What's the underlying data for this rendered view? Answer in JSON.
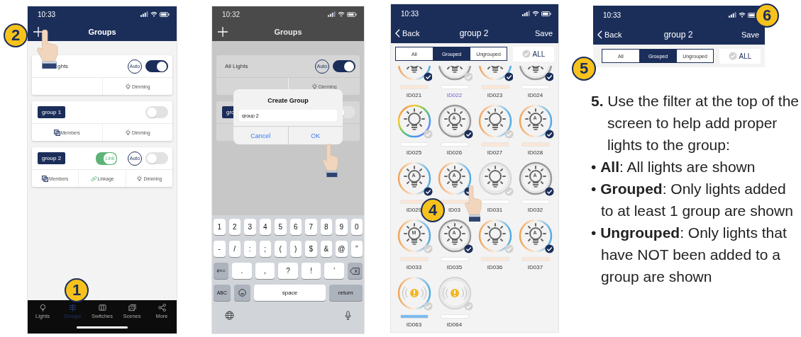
{
  "screens": [
    {
      "kind": "groups",
      "time": "10:33",
      "title": "Groups",
      "cards": [
        {
          "label": "ghts",
          "kind": "plain",
          "auto": "Auto",
          "on": true,
          "actions": [
            {
              "kind": "empty"
            },
            {
              "kind": "dimming",
              "label": "Dimming"
            }
          ]
        },
        {
          "label": "group 1",
          "kind": "tag",
          "on": false,
          "actions": [
            {
              "kind": "members",
              "label": "Members"
            },
            {
              "kind": "dimming",
              "label": "Dimming"
            }
          ]
        },
        {
          "label": "group 2",
          "kind": "tag",
          "link": "Link",
          "link_on": true,
          "auto": "Auto",
          "on": false,
          "actions": [
            {
              "kind": "members",
              "label": "Members"
            },
            {
              "kind": "linkage",
              "label": "Linkage"
            },
            {
              "kind": "dimming",
              "label": "Dimming"
            }
          ]
        }
      ],
      "tabs": [
        {
          "kind": "lights",
          "label": "Lights",
          "selected": false
        },
        {
          "kind": "groups",
          "label": "Groups",
          "selected": true
        },
        {
          "kind": "switches",
          "label": "Switches",
          "selected": false
        },
        {
          "kind": "scenes",
          "label": "Scenes",
          "selected": false
        },
        {
          "kind": "more",
          "label": "More",
          "selected": false
        }
      ]
    },
    {
      "kind": "create_group",
      "time": "10:32",
      "title": "Groups",
      "cards": [
        {
          "label": "All Lights",
          "kind": "plain",
          "auto": "Auto",
          "on": true,
          "actions": [
            {
              "kind": "empty"
            },
            {
              "kind": "dimming",
              "label": "Dimming"
            }
          ]
        },
        {
          "label": "gro",
          "kind": "tag",
          "on": false
        }
      ],
      "dialog": {
        "title": "Create Group",
        "value": "group 2",
        "buttons": [
          "Cancel",
          "OK"
        ]
      },
      "keyboard": [
        [
          {
            "kind": "char",
            "label": "1"
          },
          {
            "kind": "char",
            "label": "2"
          },
          {
            "kind": "char",
            "label": "3"
          },
          {
            "kind": "char",
            "label": "4"
          },
          {
            "kind": "char",
            "label": "5"
          },
          {
            "kind": "char",
            "label": "6"
          },
          {
            "kind": "char",
            "label": "7"
          },
          {
            "kind": "char",
            "label": "8"
          },
          {
            "kind": "char",
            "label": "9"
          },
          {
            "kind": "char",
            "label": "0"
          }
        ],
        [
          {
            "kind": "char",
            "label": "-"
          },
          {
            "kind": "char",
            "label": "/"
          },
          {
            "kind": "char",
            "label": ":"
          },
          {
            "kind": "char",
            "label": ";"
          },
          {
            "kind": "char",
            "label": "("
          },
          {
            "kind": "char",
            "label": ")"
          },
          {
            "kind": "char",
            "label": "$"
          },
          {
            "kind": "char",
            "label": "&"
          },
          {
            "kind": "char",
            "label": "@"
          },
          {
            "kind": "char",
            "label": "”"
          }
        ],
        [
          {
            "kind": "func",
            "label": "#+="
          },
          {
            "kind": "wide",
            "label": "."
          },
          {
            "kind": "wide",
            "label": ","
          },
          {
            "kind": "wide",
            "label": "?"
          },
          {
            "kind": "wide",
            "label": "!"
          },
          {
            "kind": "wide",
            "label": "’"
          },
          {
            "kind": "backspace"
          }
        ],
        [
          {
            "kind": "func",
            "label": "ABC"
          },
          {
            "kind": "emoji"
          },
          {
            "kind": "space",
            "label": "space"
          },
          {
            "kind": "return",
            "label": "return"
          }
        ],
        [
          {
            "kind": "globe"
          },
          {
            "kind": "mic"
          }
        ]
      ]
    },
    {
      "kind": "members",
      "time": "10:33",
      "back": "Back",
      "title": "group 2",
      "save": "Save",
      "filters": [
        {
          "label": "All",
          "selected": false
        },
        {
          "label": "Grouped",
          "selected": true
        },
        {
          "label": "Ungrouped",
          "selected": false
        }
      ],
      "select_all": {
        "label": "ALL",
        "checked": false
      },
      "lights": [
        {
          "id": "ID021",
          "kind": "warm",
          "checked": true,
          "color": "#fbe6d6",
          "highlighted": false
        },
        {
          "id": "ID022",
          "kind": "grey",
          "checked": false,
          "color": "#ffffff",
          "highlighted": true
        },
        {
          "id": "ID023",
          "kind": "warm",
          "checked": true,
          "color": "#fbe6d6",
          "highlighted": false
        },
        {
          "id": "ID024",
          "kind": "grey",
          "checked": true,
          "color": "#ffffff",
          "highlighted": false
        },
        {
          "id": "ID025",
          "kind": "rainbow",
          "checked": false,
          "color": "#ffffff",
          "highlighted": false
        },
        {
          "id": "ID026",
          "kind": "grey",
          "letter": "A",
          "checked": true,
          "color": "#ffffff",
          "highlighted": false
        },
        {
          "id": "ID027",
          "kind": "warm",
          "checked": false,
          "color": "#fbe6d6",
          "highlighted": false
        },
        {
          "id": "ID028",
          "kind": "warm",
          "letter": "A",
          "checked": true,
          "color": "#fbe6d6",
          "highlighted": false
        },
        {
          "id": "ID029",
          "kind": "warm",
          "letter": "A",
          "checked": true,
          "color": "#fbe6d6",
          "highlighted": false
        },
        {
          "id": "ID03",
          "kind": "warm",
          "letter": "A",
          "checked": true,
          "color": "#fbe6d6",
          "highlighted": false
        },
        {
          "id": "ID031",
          "kind": "faint",
          "checked": false,
          "color": "#ffffff",
          "highlighted": false
        },
        {
          "id": "ID032",
          "kind": "grey",
          "letter": "A",
          "checked": true,
          "color": "#ffffff",
          "highlighted": false
        },
        {
          "id": "ID033",
          "kind": "warm",
          "letter": "M",
          "checked": false,
          "color": "#fbe6d6",
          "highlighted": false
        },
        {
          "id": "ID035",
          "kind": "grey",
          "letter": "A",
          "checked": true,
          "color": "#ffffff",
          "highlighted": false
        },
        {
          "id": "ID036",
          "kind": "warm",
          "checked": false,
          "color": "#fbe6d6",
          "highlighted": false
        },
        {
          "id": "ID037",
          "kind": "warm",
          "letter": "A",
          "checked": true,
          "color": "#fbe6d6",
          "highlighted": false
        },
        {
          "id": "ID063",
          "kind": "warmsensor",
          "checked": false,
          "color": "#7dbbef",
          "highlighted": false
        },
        {
          "id": "ID064",
          "kind": "faintsensor",
          "checked": false,
          "color": "#ffffff",
          "highlighted": false
        }
      ]
    },
    {
      "kind": "members_header",
      "time": "10:33",
      "back": "Back",
      "title": "group 2",
      "save": "Save",
      "filters": [
        {
          "label": "All",
          "selected": false
        },
        {
          "label": "Grouped",
          "selected": true
        },
        {
          "label": "Ungrouped",
          "selected": false
        }
      ],
      "select_all": {
        "label": "ALL",
        "checked": false
      }
    }
  ],
  "instructions": [
    {
      "kind": "step",
      "text": "**5.** Use the filter at the top of the screen to help add proper lights to the group:"
    },
    {
      "kind": "bullet",
      "text": "• **All**: All lights are shown"
    },
    {
      "kind": "bullet",
      "text": "• **Grouped**: Only lights added to at least 1 group are shown"
    },
    {
      "kind": "bullet",
      "text": "• **Ungrouped**: Only lights that have NOT been added to a group are shown"
    }
  ],
  "callouts": [
    "1",
    "2",
    "4",
    "5",
    "6"
  ]
}
